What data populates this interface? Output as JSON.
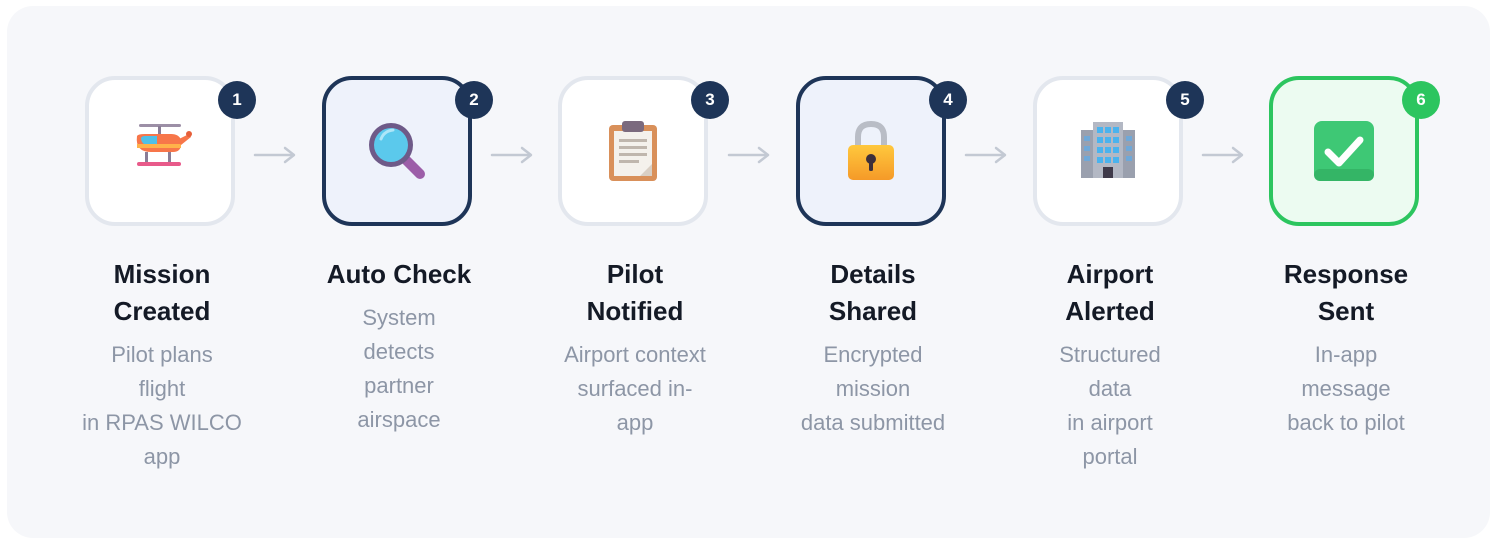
{
  "steps": [
    {
      "number": "1",
      "title": "Mission\nCreated",
      "description": "Pilot plans\nflight\nin RPAS WILCO\napp",
      "icon": "helicopter-icon",
      "state": "default"
    },
    {
      "number": "2",
      "title": "Auto Check",
      "description": "System\ndetects\npartner\nairspace",
      "icon": "magnifier-icon",
      "state": "active"
    },
    {
      "number": "3",
      "title": "Pilot\nNotified",
      "description": "Airport context\nsurfaced in-\napp",
      "icon": "clipboard-icon",
      "state": "default"
    },
    {
      "number": "4",
      "title": "Details\nShared",
      "description": "Encrypted\nmission\ndata submitted",
      "icon": "lock-icon",
      "state": "active"
    },
    {
      "number": "5",
      "title": "Airport\nAlerted",
      "description": "Structured\ndata\nin airport\nportal",
      "icon": "building-icon",
      "state": "default"
    },
    {
      "number": "6",
      "title": "Response\nSent",
      "description": "In-app\nmessage\nback to pilot",
      "icon": "check-box-icon",
      "state": "success"
    }
  ],
  "colors": {
    "panel": "#f6f7fa",
    "active_border": "#1e3558",
    "success": "#2cc55f",
    "title_text": "#141a26",
    "description_text": "#8d96a6",
    "arrow": "#c3c9d3"
  }
}
